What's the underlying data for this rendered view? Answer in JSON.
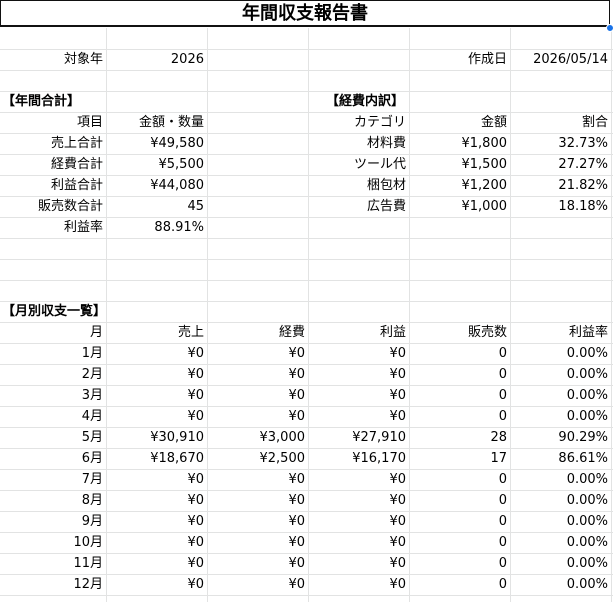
{
  "title": "年間収支報告書",
  "colors": {
    "grid": "#e2e3e3",
    "selection": "#1a73e8"
  },
  "meta": {
    "year_label": "対象年",
    "year_value": "2026",
    "created_label": "作成日",
    "created_value": "2026/05/14"
  },
  "summary": {
    "heading": "【年間合計】",
    "col_item": "項目",
    "col_value": "金額・数量",
    "rows": [
      {
        "label": "売上合計",
        "value": "¥49,580"
      },
      {
        "label": "経費合計",
        "value": "¥5,500"
      },
      {
        "label": "利益合計",
        "value": "¥44,080"
      },
      {
        "label": "販売数合計",
        "value": "45"
      },
      {
        "label": "利益率",
        "value": "88.91%"
      }
    ]
  },
  "expenses": {
    "heading": "【経費内訳】",
    "col_category": "カテゴリ",
    "col_amount": "金額",
    "col_ratio": "割合",
    "rows": [
      {
        "category": "材料費",
        "amount": "¥1,800",
        "ratio": "32.73%"
      },
      {
        "category": "ツール代",
        "amount": "¥1,500",
        "ratio": "27.27%"
      },
      {
        "category": "梱包材",
        "amount": "¥1,200",
        "ratio": "21.82%"
      },
      {
        "category": "広告費",
        "amount": "¥1,000",
        "ratio": "18.18%"
      }
    ]
  },
  "monthly": {
    "heading": "【月別収支一覧】",
    "headers": [
      "月",
      "売上",
      "経費",
      "利益",
      "販売数",
      "利益率"
    ],
    "rows": [
      [
        "1月",
        "¥0",
        "¥0",
        "¥0",
        "0",
        "0.00%"
      ],
      [
        "2月",
        "¥0",
        "¥0",
        "¥0",
        "0",
        "0.00%"
      ],
      [
        "3月",
        "¥0",
        "¥0",
        "¥0",
        "0",
        "0.00%"
      ],
      [
        "4月",
        "¥0",
        "¥0",
        "¥0",
        "0",
        "0.00%"
      ],
      [
        "5月",
        "¥30,910",
        "¥3,000",
        "¥27,910",
        "28",
        "90.29%"
      ],
      [
        "6月",
        "¥18,670",
        "¥2,500",
        "¥16,170",
        "17",
        "86.61%"
      ],
      [
        "7月",
        "¥0",
        "¥0",
        "¥0",
        "0",
        "0.00%"
      ],
      [
        "8月",
        "¥0",
        "¥0",
        "¥0",
        "0",
        "0.00%"
      ],
      [
        "9月",
        "¥0",
        "¥0",
        "¥0",
        "0",
        "0.00%"
      ],
      [
        "10月",
        "¥0",
        "¥0",
        "¥0",
        "0",
        "0.00%"
      ],
      [
        "11月",
        "¥0",
        "¥0",
        "¥0",
        "0",
        "0.00%"
      ],
      [
        "12月",
        "¥0",
        "¥0",
        "¥0",
        "0",
        "0.00%"
      ]
    ]
  }
}
